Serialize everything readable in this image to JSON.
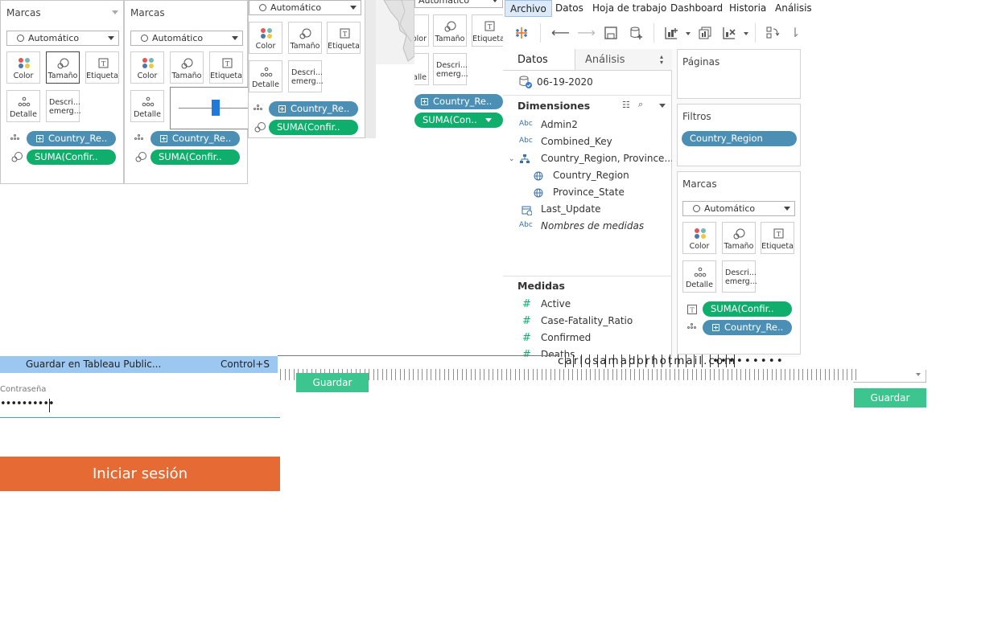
{
  "marks_panel_1": {
    "title": "Marcas",
    "mark_type": "Automático",
    "cards": [
      "Color",
      "Tamaño",
      "Etiqueta",
      "Detalle",
      "Descri... emerg..."
    ],
    "pills": [
      "Country_Re..",
      "SUMA(Confir.."
    ]
  },
  "marks_panel_2": {
    "title": "Marcas",
    "mark_type": "Automático",
    "cards": [
      "Color",
      "Tamaño",
      "Etiqueta",
      "Detalle"
    ],
    "pills": [
      "Country_Re..",
      "SUMA(Confir.."
    ]
  },
  "marks_panel_3": {
    "mark_type": "Automático",
    "cards": [
      "Color",
      "Tamaño",
      "Etiqueta",
      "Detalle",
      "Descri... emerg..."
    ],
    "pills": [
      "Country_Re..",
      "SUMA(Confir.."
    ]
  },
  "marks_panel_4": {
    "mark_type": "Automático",
    "cards": [
      "olor",
      "Tamaño",
      "Etiqueta",
      "etalle",
      "Descri... emerg..."
    ],
    "pills": [
      "Country_Re..",
      "SUMA(Con.."
    ]
  },
  "menubar": {
    "items": [
      "Archivo",
      "Datos",
      "Hoja de trabajo",
      "Dashboard",
      "Historia",
      "Análisis"
    ]
  },
  "data_pane": {
    "tabs": [
      "Datos",
      "Análisis"
    ],
    "datasource": "06-19-2020",
    "dimensions_header": "Dimensiones",
    "dimensions": [
      {
        "type": "Abc",
        "name": "Admin2"
      },
      {
        "type": "Abc",
        "name": "Combined_Key"
      },
      {
        "type": "hier",
        "name": "Country_Region, Province..."
      },
      {
        "type": "geo",
        "name": "Country_Region"
      },
      {
        "type": "geo",
        "name": "Province_State"
      },
      {
        "type": "date",
        "name": "Last_Update"
      },
      {
        "type": "Abc",
        "name": "Nombres de medidas"
      }
    ],
    "measures_header": "Medidas",
    "measures": [
      "Active",
      "Case-Fatality_Ratio",
      "Confirmed",
      "Deaths"
    ]
  },
  "shelves": {
    "pages_title": "Páginas",
    "filters_title": "Filtros",
    "filter_pill": "Country_Region",
    "marks_title": "Marcas",
    "mark_type": "Automático",
    "cards": [
      "Color",
      "Tamaño",
      "Etiqueta",
      "Detalle",
      "Descri... emerg..."
    ],
    "pills": [
      "SUMA(Confir..",
      "Country_Re.."
    ]
  },
  "file_menu": {
    "item": "Guardar en Tableau Public...",
    "shortcut": "Control+S"
  },
  "login": {
    "password_label": "Contraseña",
    "password_value": "••••••••••",
    "button": "Iniciar sesión"
  },
  "save_dialog": {
    "email": "carlosamadorhotmail.com",
    "save_label": "Guardar",
    "save_label_2": "Guardar"
  }
}
